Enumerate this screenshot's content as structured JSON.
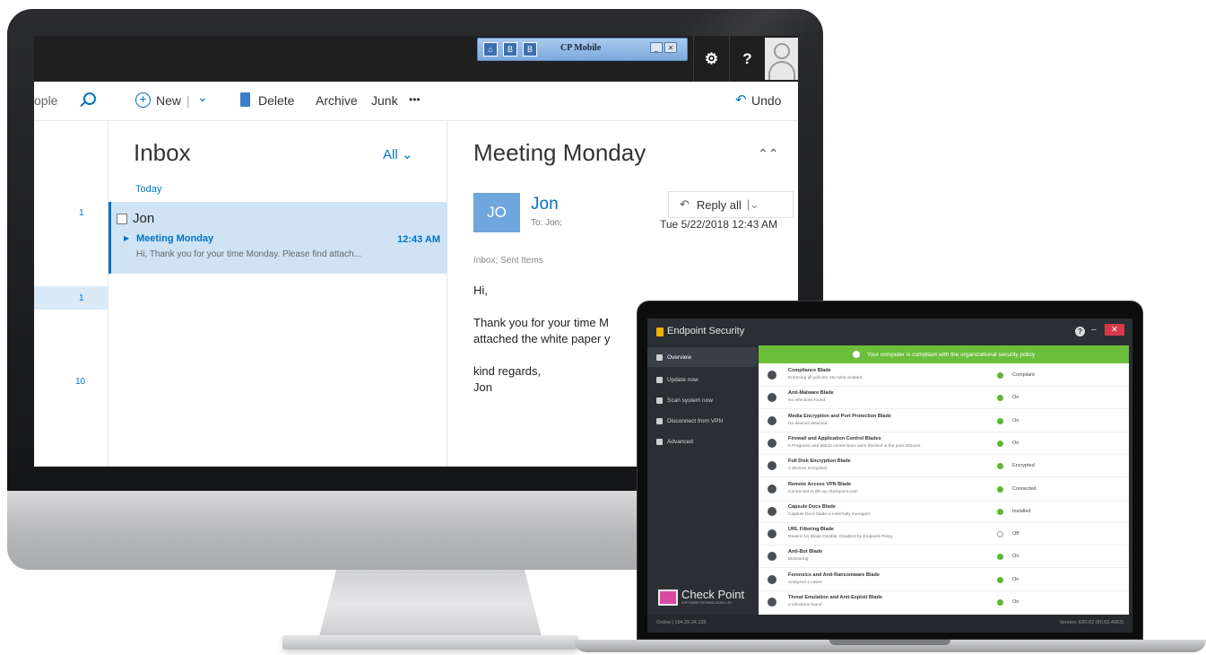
{
  "outlook": {
    "cp_mobile": {
      "title": "CP Mobile",
      "icon_labels": [
        "⌂",
        "B",
        "B"
      ],
      "minimize": "_",
      "close": "✕"
    },
    "topbar": {
      "settings_icon": "gear-icon",
      "help_label": "?"
    },
    "toolbar": {
      "search_fragment": "ople",
      "new_label": "New",
      "new_separator": "|",
      "new_dropdown": "⌄",
      "delete_label": "Delete",
      "archive_label": "Archive",
      "junk_label": "Junk",
      "more_label": "•••",
      "undo_label": "Undo"
    },
    "nav_counts": [
      "1",
      "1",
      "10"
    ],
    "list": {
      "title": "Inbox",
      "filter_label": "All",
      "group_label": "Today",
      "message": {
        "sender": "Jon",
        "subject": "Meeting Monday",
        "time": "12:43 AM",
        "preview": "Hi,  Thank you for your time Monday. Please find attach..."
      }
    },
    "reading": {
      "subject": "Meeting Monday",
      "collapse_label": "⌃⌃",
      "avatar_initials": "JO",
      "from": "Jon",
      "to": "To: Jon;",
      "reply_label": "Reply all",
      "reply_dropdown": "|⌄",
      "date": "Tue 5/22/2018 12:43 AM",
      "folders": "Inbox; Sent Items",
      "body": "Hi,\n\nThank you for your time M\nattached the white paper y\n\nkind regards,\nJon"
    }
  },
  "endpoint": {
    "title": "Endpoint Security",
    "help": "?",
    "minimize": "–",
    "close": "✕",
    "sidebar": [
      {
        "label": "Overview"
      },
      {
        "label": "Update now"
      },
      {
        "label": "Scan system now"
      },
      {
        "label": "Disconnect from VPN"
      },
      {
        "label": "Advanced"
      }
    ],
    "logo": {
      "name": "Check Point",
      "tagline": "SOFTWARE TECHNOLOGIES LTD."
    },
    "banner": "Your computer is compliant with the organizational security policy",
    "blades": [
      {
        "name": "Compliance Blade",
        "desc": "Enforcing all policies. No rules violated.",
        "status": "Compliant",
        "ok": true
      },
      {
        "name": "Anti-Malware Blade",
        "desc": "No infections found",
        "status": "On",
        "ok": true
      },
      {
        "name": "Media Encryption and Port Protection Blade",
        "desc": "No devices detected",
        "status": "On",
        "ok": true
      },
      {
        "name": "Firewall and Application Control Blades",
        "desc": "0 Programs and 86542 connections were blocked in the past 24hours",
        "status": "On",
        "ok": true
      },
      {
        "name": "Full Disk Encryption Blade",
        "desc": "2 devices encrypted.",
        "status": "Encrypted",
        "ok": true
      },
      {
        "name": "Remote Access VPN Blade",
        "desc": "Connected to dfv-cp.checkpoint.com",
        "status": "Connected",
        "ok": true
      },
      {
        "name": "Capsule Docs Blade",
        "desc": "Capsule Docs blade is externally managed",
        "status": "Installed",
        "ok": true
      },
      {
        "name": "URL Filtering Blade",
        "desc": "Reason for Blade Disable: Disabled by Endpoint Policy",
        "status": "Off",
        "ok": false
      },
      {
        "name": "Anti-Bot Blade",
        "desc": "Monitoring",
        "status": "On",
        "ok": true
      },
      {
        "name": "Forensics and Anti-Ransomware Blade",
        "desc": "Analyzed 2 cases",
        "status": "On",
        "ok": true
      },
      {
        "name": "Threat Emulation and Anti-Exploit Blade",
        "desc": "2 infections found",
        "status": "On",
        "ok": true
      }
    ],
    "status_left": "Online  |  194.29.24.135",
    "status_right": "Version: E80.62 (80.62.4063)"
  }
}
